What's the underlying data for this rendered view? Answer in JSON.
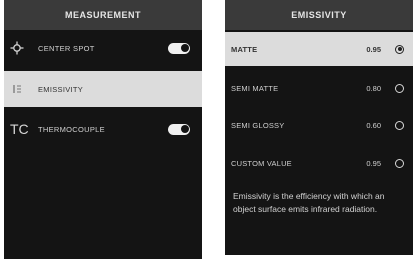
{
  "measurement_panel": {
    "title": "MEASUREMENT",
    "items": [
      {
        "label": "CENTER SPOT",
        "icon": "crosshair-icon",
        "toggle": true,
        "selected": false
      },
      {
        "label": "EMISSIVITY",
        "icon": "emissivity-icon",
        "toggle": null,
        "selected": true
      },
      {
        "label": "THERMOCOUPLE",
        "icon_text": "TC",
        "toggle": true,
        "selected": false
      }
    ]
  },
  "emissivity_panel": {
    "title": "EMISSIVITY",
    "options": [
      {
        "label": "MATTE",
        "value": "0.95",
        "selected": true
      },
      {
        "label": "SEMI MATTE",
        "value": "0.80",
        "selected": false
      },
      {
        "label": "SEMI GLOSSY",
        "value": "0.60",
        "selected": false
      },
      {
        "label": "CUSTOM VALUE",
        "value": "0.95",
        "selected": false
      }
    ],
    "description": "Emissivity is the efficiency with which an object surface emits infrared radiation."
  }
}
